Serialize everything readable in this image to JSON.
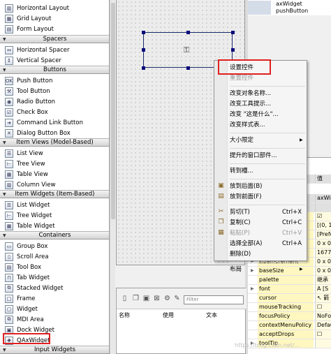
{
  "widget_box": {
    "items_top": [
      {
        "label": "Horizontal Layout",
        "icon": "horizontal-layout-icon",
        "glyph": "▥"
      },
      {
        "label": "Grid Layout",
        "icon": "grid-layout-icon",
        "glyph": "▦"
      },
      {
        "label": "Form Layout",
        "icon": "form-layout-icon",
        "glyph": "▤"
      }
    ],
    "cat_spacers": "Spacers",
    "spacers": [
      {
        "label": "Horizontal Spacer",
        "icon": "horizontal-spacer-icon",
        "glyph": "↔"
      },
      {
        "label": "Vertical Spacer",
        "icon": "vertical-spacer-icon",
        "glyph": "↕"
      }
    ],
    "cat_buttons": "Buttons",
    "buttons": [
      {
        "label": "Push Button",
        "icon": "push-button-icon",
        "glyph": "OK"
      },
      {
        "label": "Tool Button",
        "icon": "tool-button-icon",
        "glyph": "⚒"
      },
      {
        "label": "Radio Button",
        "icon": "radio-button-icon",
        "glyph": "◉"
      },
      {
        "label": "Check Box",
        "icon": "check-box-icon",
        "glyph": "☑"
      },
      {
        "label": "Command Link Button",
        "icon": "command-link-icon",
        "glyph": "➜"
      },
      {
        "label": "Dialog Button Box",
        "icon": "dialog-button-box-icon",
        "glyph": "✕"
      }
    ],
    "cat_item_views": "Item Views (Model-Based)",
    "item_views": [
      {
        "label": "List View",
        "icon": "list-view-icon",
        "glyph": "☰"
      },
      {
        "label": "Tree View",
        "icon": "tree-view-icon",
        "glyph": "⊢"
      },
      {
        "label": "Table View",
        "icon": "table-view-icon",
        "glyph": "▦"
      },
      {
        "label": "Column View",
        "icon": "column-view-icon",
        "glyph": "▥"
      }
    ],
    "cat_item_widgets": "Item Widgets (Item-Based)",
    "item_widgets": [
      {
        "label": "List Widget",
        "icon": "list-widget-icon",
        "glyph": "☰"
      },
      {
        "label": "Tree Widget",
        "icon": "tree-widget-icon",
        "glyph": "⊢"
      },
      {
        "label": "Table Widget",
        "icon": "table-widget-icon",
        "glyph": "▦"
      }
    ],
    "cat_containers": "Containers",
    "containers": [
      {
        "label": "Group Box",
        "icon": "group-box-icon",
        "glyph": "▭"
      },
      {
        "label": "Scroll Area",
        "icon": "scroll-area-icon",
        "glyph": "▯"
      },
      {
        "label": "Tool Box",
        "icon": "tool-box-icon",
        "glyph": "▤"
      },
      {
        "label": "Tab Widget",
        "icon": "tab-widget-icon",
        "glyph": "⊓"
      },
      {
        "label": "Stacked Widget",
        "icon": "stacked-widget-icon",
        "glyph": "⧉"
      },
      {
        "label": "Frame",
        "icon": "frame-icon",
        "glyph": "□"
      },
      {
        "label": "Widget",
        "icon": "widget-icon",
        "glyph": "▢"
      },
      {
        "label": "MDI Area",
        "icon": "mdi-area-icon",
        "glyph": "⧉"
      },
      {
        "label": "Dock Widget",
        "icon": "dock-widget-icon",
        "glyph": "▣"
      },
      {
        "label": "QAxWidget",
        "icon": "qaxwidget-icon",
        "glyph": "✚"
      }
    ],
    "cat_input_widgets": "Input Widgets"
  },
  "object_inspector": {
    "rows": [
      {
        "name": "axWidget",
        "class": ""
      },
      {
        "name": "pushButton",
        "class": ""
      }
    ]
  },
  "context_menu": {
    "items": [
      {
        "label": "设置控件",
        "shortcut": "",
        "disabled": false,
        "icon": ""
      },
      {
        "label": "重置控件",
        "shortcut": "",
        "disabled": true,
        "icon": ""
      },
      {
        "label": "改变对象名称...",
        "shortcut": "",
        "disabled": false,
        "icon": ""
      },
      {
        "label": "改变工具提示...",
        "shortcut": "",
        "disabled": false,
        "icon": ""
      },
      {
        "label": "改变 \"这是什么\"...",
        "shortcut": "",
        "disabled": false,
        "icon": ""
      },
      {
        "label": "改变样式表...",
        "shortcut": "",
        "disabled": false,
        "icon": ""
      },
      {
        "label": "大小限定",
        "shortcut": "",
        "disabled": false,
        "icon": "",
        "submenu": true
      },
      {
        "label": "提升的窗口部件...",
        "shortcut": "",
        "disabled": false,
        "icon": ""
      },
      {
        "label": "转到槽...",
        "shortcut": "",
        "disabled": false,
        "icon": ""
      },
      {
        "label": "放到后面(B)",
        "shortcut": "",
        "disabled": false,
        "icon": "send-to-back-icon"
      },
      {
        "label": "放到前面(F)",
        "shortcut": "",
        "disabled": false,
        "icon": "bring-to-front-icon"
      },
      {
        "label": "剪切(T)",
        "shortcut": "Ctrl+X",
        "disabled": false,
        "icon": "cut-icon"
      },
      {
        "label": "复制(C)",
        "shortcut": "Ctrl+C",
        "disabled": false,
        "icon": "copy-icon"
      },
      {
        "label": "粘贴(P)",
        "shortcut": "Ctrl+V",
        "disabled": true,
        "icon": "paste-icon"
      },
      {
        "label": "选择全部(A)",
        "shortcut": "Ctrl+A",
        "disabled": false,
        "icon": ""
      },
      {
        "label": "删除(D)",
        "shortcut": "",
        "disabled": false,
        "icon": ""
      },
      {
        "label": "布局",
        "shortcut": "",
        "disabled": false,
        "icon": "",
        "submenu": true
      }
    ]
  },
  "action_editor": {
    "filter_placeholder": "Filter",
    "columns": [
      "名称",
      "使用",
      "文本"
    ]
  },
  "property_editor": {
    "header_value": "值",
    "rows": [
      {
        "name": "",
        "value": "axWic",
        "yellow": false,
        "expand": false,
        "header": true
      },
      {
        "name": "",
        "value": "",
        "yellow": false,
        "expand": false,
        "header": true
      },
      {
        "name": "",
        "value": "☑",
        "yellow": true,
        "expand": false,
        "header": false
      },
      {
        "name": "",
        "value": "[(0, 1",
        "yellow": true,
        "expand": false,
        "header": false
      },
      {
        "name": "",
        "value": "[Prefe",
        "yellow": true,
        "expand": false,
        "header": false
      },
      {
        "name": "",
        "value": "0 x 0",
        "yellow": true,
        "expand": false,
        "header": false
      },
      {
        "name": "",
        "value": "16777",
        "yellow": true,
        "expand": false,
        "header": false
      },
      {
        "name": "sizeIncrement",
        "value": "0 x 0",
        "yellow": true,
        "expand": true,
        "header": false
      },
      {
        "name": "baseSize",
        "value": "0 x 0",
        "yellow": true,
        "expand": true,
        "header": false
      },
      {
        "name": "palette",
        "value": "继承",
        "yellow": true,
        "expand": false,
        "header": false
      },
      {
        "name": "font",
        "value": "A [S",
        "yellow": true,
        "expand": true,
        "header": false
      },
      {
        "name": "cursor",
        "value": "↖ 箭",
        "yellow": true,
        "expand": false,
        "header": false
      },
      {
        "name": "mouseTracking",
        "value": "☐",
        "yellow": true,
        "expand": false,
        "header": false
      },
      {
        "name": "focusPolicy",
        "value": "NoFo",
        "yellow": true,
        "expand": false,
        "header": false
      },
      {
        "name": "contextMenuPolicy",
        "value": "Defau",
        "yellow": true,
        "expand": false,
        "header": false
      },
      {
        "name": "acceptDrops",
        "value": "☐",
        "yellow": true,
        "expand": false,
        "header": false
      },
      {
        "name": "toolTip",
        "value": "",
        "yellow": true,
        "expand": true,
        "header": false
      }
    ]
  },
  "watermark": "https://blog.csdn.net/..."
}
